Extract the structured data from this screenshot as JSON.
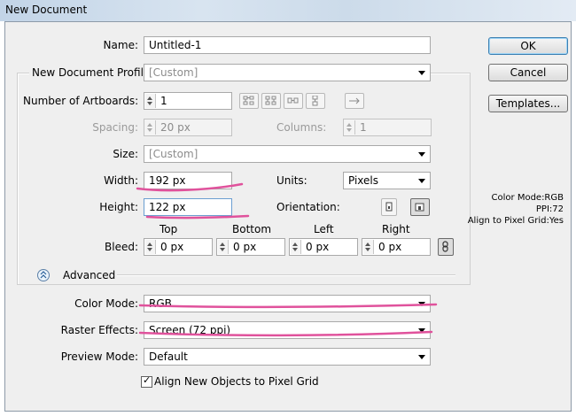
{
  "window": {
    "title": "New Document"
  },
  "form": {
    "name_label": "Name:",
    "name_value": "Untitled-1",
    "profile_label": "New Document Profile:",
    "profile_value": "[Custom]",
    "artboards_label": "Number of Artboards:",
    "artboards_value": "1",
    "spacing_label": "Spacing:",
    "spacing_value": "20 px",
    "columns_label": "Columns:",
    "columns_value": "1",
    "size_label": "Size:",
    "size_value": "[Custom]",
    "width_label": "Width:",
    "width_value": "192 px",
    "units_label": "Units:",
    "units_value": "Pixels",
    "height_label": "Height:",
    "height_value": "122 px",
    "orientation_label": "Orientation:",
    "bleed_label": "Bleed:",
    "bleed": [
      {
        "label": "Top",
        "value": "0 px"
      },
      {
        "label": "Bottom",
        "value": "0 px"
      },
      {
        "label": "Left",
        "value": "0 px"
      },
      {
        "label": "Right",
        "value": "0 px"
      }
    ],
    "advanced_label": "Advanced",
    "color_mode_label": "Color Mode:",
    "color_mode_value": "RGB",
    "raster_label": "Raster Effects:",
    "raster_value": "Screen (72 ppi)",
    "preview_label": "Preview Mode:",
    "preview_value": "Default",
    "align_label": "Align New Objects to Pixel Grid",
    "align_checked": true
  },
  "buttons": {
    "ok": "OK",
    "cancel": "Cancel",
    "templates": "Templates..."
  },
  "info": {
    "color_mode": "Color Mode:RGB",
    "ppi": "PPI:72",
    "align": "Align to Pixel Grid:Yes"
  },
  "colors": {
    "highlight": "#e0529c",
    "default_border": "#3c7fb1"
  }
}
